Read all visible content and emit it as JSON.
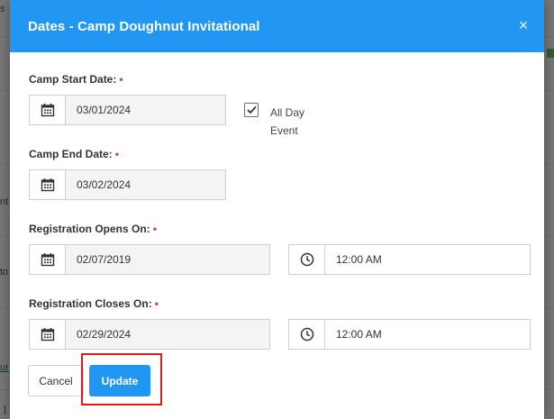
{
  "modal": {
    "title": "Dates - Camp Doughnut Invitational",
    "close_glyph": "×"
  },
  "fields": {
    "camp_start": {
      "label": "Camp Start Date:",
      "value": "03/01/2024"
    },
    "all_day": {
      "label": "All Day Event",
      "checked": true
    },
    "camp_end": {
      "label": "Camp End Date:",
      "value": "03/02/2024"
    },
    "reg_opens": {
      "label": "Registration Opens On:",
      "date": "02/07/2019",
      "time": "12:00 AM"
    },
    "reg_closes": {
      "label": "Registration Closes On:",
      "date": "02/29/2024",
      "time": "12:00 AM"
    },
    "required_marker": "•"
  },
  "buttons": {
    "cancel": "Cancel",
    "update": "Update"
  },
  "background": {
    "fragments": [
      "s",
      "nt",
      "to",
      "ur",
      "I"
    ]
  },
  "colors": {
    "header": "#2196f3",
    "primary": "#2196f3",
    "required": "#e53935",
    "highlight": "#e01b1b"
  },
  "icons": {
    "date": "calendar-icon",
    "time": "clock-icon",
    "close": "close-icon",
    "check": "check-icon"
  }
}
